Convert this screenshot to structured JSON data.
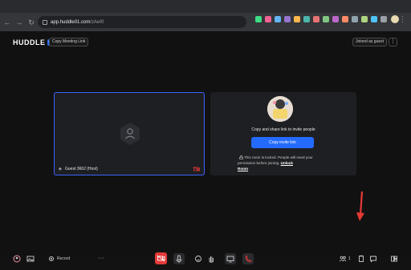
{
  "browser": {
    "url_host": "app.huddle01.com",
    "url_path": "/zAeI0"
  },
  "header": {
    "logo_text": "HUDDLE",
    "logo_badge": "01",
    "copy_link_label": "Copy Meeting Link",
    "joined_label": "Joined as guest",
    "more_label": "⋮"
  },
  "tile": {
    "name": "Guest 3662 (Host)"
  },
  "invite": {
    "prompt": "Copy and share link to invite people",
    "button_label": "Copy invite link",
    "lock_note": "This room is locked. People will need your permission before joining.",
    "unlock_label": "Unlock",
    "room_label": "Room"
  },
  "bottombar": {
    "record_label": "Record",
    "more_label": "···",
    "peer_count": "1"
  },
  "colors": {
    "accent": "#246bfd",
    "danger": "#e33a3a",
    "annotation_arrow": "#e53935"
  }
}
